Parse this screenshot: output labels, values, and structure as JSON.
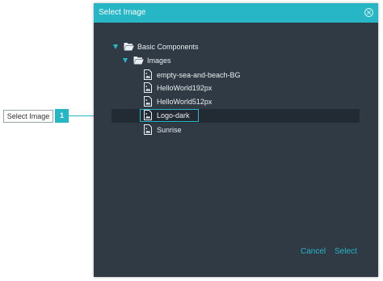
{
  "dialog": {
    "title": "Select Image",
    "cancel_label": "Cancel",
    "select_label": "Select"
  },
  "tree": {
    "root": {
      "label": "Basic Components",
      "expanded": true,
      "icon": "folder-open-icon"
    },
    "folder": {
      "label": "Images",
      "expanded": true,
      "icon": "folder-open-icon"
    },
    "files": [
      {
        "label": "empty-sea-and-beach-BG",
        "icon": "image-file-icon"
      },
      {
        "label": "HelloWorld192px",
        "icon": "image-file-icon"
      },
      {
        "label": "HelloWorld512px",
        "icon": "image-file-icon"
      },
      {
        "label": "Logo-dark",
        "icon": "image-file-icon",
        "selected": true
      },
      {
        "label": "Sunrise",
        "icon": "image-file-icon"
      }
    ]
  },
  "callout": {
    "label": "Select Image",
    "number": "1"
  },
  "colors": {
    "accent": "#26b6c6",
    "dialog_bg": "#2f3a45",
    "selected_row_bg": "#222b33",
    "text": "#e9eef2"
  }
}
